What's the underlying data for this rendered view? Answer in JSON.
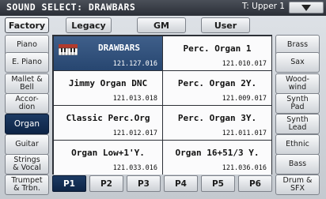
{
  "header": {
    "title": "SOUND SELECT: DRAWBARS",
    "track": "T: Upper 1",
    "menu_icon": "triangle-down-icon"
  },
  "top_tabs": [
    {
      "label": "Factory",
      "active": true
    },
    {
      "label": "Legacy",
      "active": false
    },
    {
      "label": "GM",
      "active": false
    },
    {
      "label": "User",
      "active": false
    }
  ],
  "left_categories": [
    {
      "label": "Piano",
      "active": false
    },
    {
      "label": "E. Piano",
      "active": false
    },
    {
      "label": "Mallet &\nBell",
      "active": false
    },
    {
      "label": "Accor-\ndion",
      "active": false
    },
    {
      "label": "Organ",
      "active": true
    },
    {
      "label": "Guitar",
      "active": false
    },
    {
      "label": "Strings\n& Vocal",
      "active": false
    },
    {
      "label": "Trumpet\n& Trbn.",
      "active": false
    }
  ],
  "right_categories": [
    {
      "label": "Brass",
      "active": false
    },
    {
      "label": "Sax",
      "active": false
    },
    {
      "label": "Wood-\nwind",
      "active": false
    },
    {
      "label": "Synth\nPad",
      "active": false
    },
    {
      "label": "Synth\nLead",
      "active": false
    },
    {
      "label": "Ethnic",
      "active": false
    },
    {
      "label": "Bass",
      "active": false
    },
    {
      "label": "Drum &\nSFX",
      "active": false
    }
  ],
  "sounds": [
    {
      "name": "DRAWBARS",
      "code": "121.127.016",
      "selected": true,
      "icon": "organ-keyboard-icon"
    },
    {
      "name": "Perc. Organ 1",
      "code": "121.010.017",
      "selected": false
    },
    {
      "name": "Jimmy Organ DNC",
      "code": "121.013.018",
      "selected": false
    },
    {
      "name": "Perc. Organ 2Y.",
      "code": "121.009.017",
      "selected": false
    },
    {
      "name": "Classic Perc.Org",
      "code": "121.012.017",
      "selected": false
    },
    {
      "name": "Perc. Organ 3Y.",
      "code": "121.011.017",
      "selected": false
    },
    {
      "name": "Organ Low+1'Y.",
      "code": "121.033.016",
      "selected": false
    },
    {
      "name": "Organ 16+51/3 Y.",
      "code": "121.036.016",
      "selected": false
    }
  ],
  "pages": [
    {
      "label": "P1",
      "active": true
    },
    {
      "label": "P2",
      "active": false
    },
    {
      "label": "P3",
      "active": false
    },
    {
      "label": "P4",
      "active": false
    },
    {
      "label": "P5",
      "active": false
    },
    {
      "label": "P6",
      "active": false
    }
  ],
  "colors": {
    "header_bg": "#2b2f37",
    "selected_bg": "#274670",
    "active_button_bg": "#0d2446"
  }
}
